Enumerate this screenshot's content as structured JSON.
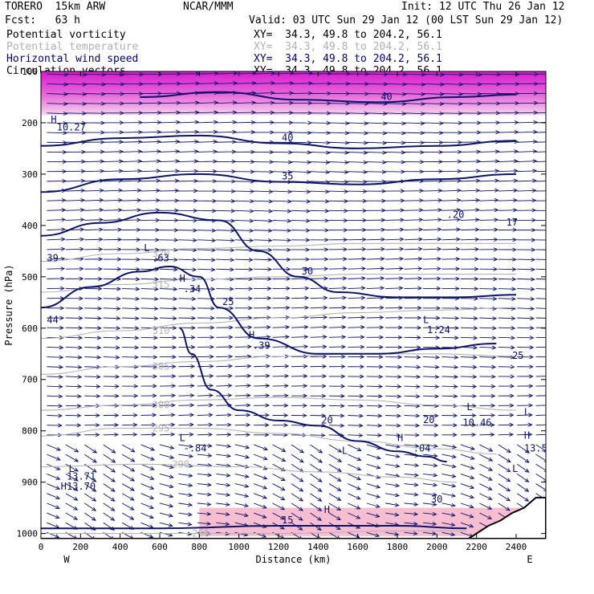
{
  "header": {
    "model": "TORERO  15km ARW",
    "center": "NCAR/MMM",
    "init": "Init: 12 UTC Thu 26 Jan 12",
    "fcst": "Fcst:   63 h",
    "valid": "Valid: 03 UTC Sun 29 Jan 12 (00 LST Sun 29 Jan 12)",
    "fields": [
      {
        "name": "Potential vorticity",
        "color": "#000000",
        "xy": "XY=  34.3, 49.8 to 204.2, 56.1"
      },
      {
        "name": "Potential temperature",
        "color": "#b0b0b0",
        "xy": "XY=  34.3, 49.8 to 204.2, 56.1"
      },
      {
        "name": "Horizontal wind speed",
        "color": "#00007a",
        "xy": "XY=  34.3, 49.8 to 204.2, 56.1"
      },
      {
        "name": "Circulation vectors",
        "color": "#000000",
        "xy": "XY=  34.3, 49.8 to 204.2, 56.1"
      }
    ]
  },
  "colors": {
    "wind": "#0c1270",
    "theta": "#b4b4b4",
    "pv_high": "#d81cd0",
    "pv_low": "#f4a8c0",
    "terrain": "#ffffff",
    "frame": "#000000"
  },
  "chart_data": {
    "type": "vertical cross-section",
    "xlabel": "Distance (km)",
    "ylabel": "Pressure (hPa)",
    "xlim": [
      0,
      2550
    ],
    "ylim": [
      1010,
      100
    ],
    "x_ticks": [
      0,
      200,
      400,
      600,
      800,
      1000,
      1200,
      1400,
      1600,
      1800,
      2000,
      2200,
      2400
    ],
    "y_ticks": [
      100,
      200,
      300,
      400,
      500,
      600,
      700,
      800,
      900,
      1000
    ],
    "end_labels": {
      "left": "W",
      "right": "E"
    },
    "terrain": {
      "x": [
        0,
        2160,
        2200,
        2260,
        2320,
        2380,
        2440,
        2500,
        2550
      ],
      "p": [
        1010,
        1010,
        1000,
        985,
        975,
        960,
        950,
        930,
        930
      ]
    },
    "theta_contours": [
      {
        "value": 286,
        "label": "286",
        "x": [
          0,
          600,
          1200,
          1800,
          2150
        ],
        "p": [
          1000,
          1000,
          1000,
          995,
          995
        ]
      },
      {
        "value": 290,
        "label": "290",
        "x": [
          0,
          500,
          1000,
          1400,
          1800,
          2100
        ],
        "p": [
          870,
          865,
          870,
          880,
          890,
          900
        ]
      },
      {
        "value": 295,
        "label": "295",
        "x": [
          0,
          400,
          800,
          1200,
          1600,
          2000,
          2300
        ],
        "p": [
          810,
          795,
          795,
          805,
          820,
          835,
          845
        ]
      },
      {
        "value": 300,
        "label": "300",
        "x": [
          0,
          400,
          800,
          1200,
          1600,
          2000,
          2400
        ],
        "p": [
          760,
          750,
          740,
          735,
          740,
          750,
          760
        ]
      },
      {
        "value": 305,
        "label": "305",
        "x": [
          0,
          400,
          800,
          1200,
          1600,
          2000,
          2400
        ],
        "p": [
          690,
          675,
          665,
          655,
          650,
          650,
          655
        ]
      },
      {
        "value": 310,
        "label": "310",
        "x": [
          0,
          400,
          800,
          1200,
          1600,
          2000,
          2400
        ],
        "p": [
          620,
          605,
          590,
          580,
          570,
          565,
          560
        ]
      },
      {
        "value": 315,
        "label": "315",
        "x": [
          0,
          400,
          800,
          1200,
          1600,
          2000,
          2400
        ],
        "p": [
          530,
          515,
          505,
          500,
          495,
          495,
          495
        ]
      },
      {
        "value": 320,
        "label": "320",
        "x": [
          0,
          400,
          800,
          1200,
          1600,
          2000,
          2400
        ],
        "p": [
          470,
          455,
          445,
          440,
          435,
          435,
          435
        ]
      }
    ],
    "wind_contours": [
      {
        "value": 15,
        "label": "15",
        "x": [
          0,
          600,
          1200,
          1800,
          2150
        ],
        "p": [
          990,
          990,
          985,
          985,
          990
        ]
      },
      {
        "value": 20,
        "label": "20",
        "x": [
          700,
          760,
          860,
          1000,
          1200,
          1400,
          1600,
          1800,
          1950,
          2050
        ],
        "p": [
          600,
          650,
          720,
          760,
          780,
          790,
          820,
          840,
          850,
          860
        ]
      },
      {
        "value": 25,
        "label": "25",
        "x": [
          0,
          250,
          500,
          650,
          800,
          900,
          1100,
          1400,
          1700,
          2000,
          2300
        ],
        "p": [
          560,
          520,
          490,
          480,
          500,
          560,
          620,
          650,
          650,
          640,
          630
        ]
      },
      {
        "value": 30,
        "label": "30",
        "x": [
          0,
          300,
          600,
          900,
          1100,
          1300,
          1500,
          1800,
          2100,
          2400
        ],
        "p": [
          420,
          395,
          375,
          390,
          450,
          500,
          530,
          540,
          540,
          535
        ]
      },
      {
        "value": 35,
        "label": "35",
        "x": [
          0,
          400,
          800,
          1200,
          1600,
          2000,
          2400
        ],
        "p": [
          335,
          310,
          300,
          315,
          320,
          310,
          300
        ]
      },
      {
        "value": 40,
        "label": "40",
        "x": [
          0,
          400,
          800,
          1200,
          1600,
          2000,
          2400
        ],
        "p": [
          245,
          230,
          225,
          240,
          250,
          245,
          235
        ]
      },
      {
        "value": 40,
        "label": "40",
        "x": [
          500,
          900,
          1300,
          1700,
          2100,
          2400
        ],
        "p": [
          150,
          140,
          155,
          160,
          150,
          145
        ]
      }
    ],
    "pv_regions": [
      {
        "name": "stratospheric PV",
        "x": [
          0,
          2550
        ],
        "p_top": 100,
        "p_bottom": 185
      },
      {
        "name": "boundary layer PV",
        "x": [
          800,
          2550
        ],
        "p_top": 950,
        "p_bottom": 1005
      }
    ],
    "annotations": [
      {
        "text": "H",
        "x": 50,
        "p": 200
      },
      {
        "text": "10.27",
        "x": 80,
        "p": 215
      },
      {
        "text": "L",
        "x": 520,
        "p": 450
      },
      {
        "text": ".63",
        "x": 560,
        "p": 470
      },
      {
        "text": "H",
        "x": 700,
        "p": 510
      },
      {
        "text": ".34",
        "x": 720,
        "p": 530
      },
      {
        "text": "H",
        "x": 1050,
        "p": 620
      },
      {
        "text": ".39",
        "x": 1070,
        "p": 640
      },
      {
        "text": "L",
        "x": 1930,
        "p": 590
      },
      {
        "text": "1.24",
        "x": 1950,
        "p": 610
      },
      {
        "text": "L",
        "x": 2150,
        "p": 760
      },
      {
        "text": "10.46",
        "x": 2130,
        "p": 790
      },
      {
        "text": "L",
        "x": 700,
        "p": 820
      },
      {
        "text": "-.84",
        "x": 720,
        "p": 840
      },
      {
        "text": "H",
        "x": 1800,
        "p": 820
      },
      {
        "text": ".04",
        "x": 1880,
        "p": 840
      },
      {
        "text": "L",
        "x": 140,
        "p": 880
      },
      {
        "text": "13.71",
        "x": 130,
        "p": 895
      },
      {
        "text": "H",
        "x": 100,
        "p": 915
      },
      {
        "text": "13.70",
        "x": 130,
        "p": 915
      },
      {
        "text": "L",
        "x": 1520,
        "p": 845
      },
      {
        "text": "H",
        "x": 1430,
        "p": 960
      },
      {
        "text": "L",
        "x": 2380,
        "p": 880
      },
      {
        "text": "13.5",
        "x": 2440,
        "p": 840
      },
      {
        "text": "H",
        "x": 2440,
        "p": 815
      },
      {
        "text": "L",
        "x": 2440,
        "p": 770
      },
      {
        "text": "44",
        "x": 30,
        "p": 590
      },
      {
        "text": "39",
        "x": 30,
        "p": 470
      },
      {
        "text": ".20",
        "x": 2050,
        "p": 385
      },
      {
        "text": "17",
        "x": 2350,
        "p": 400
      },
      {
        "text": "30",
        "x": 1970,
        "p": 940
      },
      {
        "text": "25",
        "x": 2380,
        "p": 660
      },
      {
        "text": "20",
        "x": 1930,
        "p": 785
      }
    ]
  }
}
